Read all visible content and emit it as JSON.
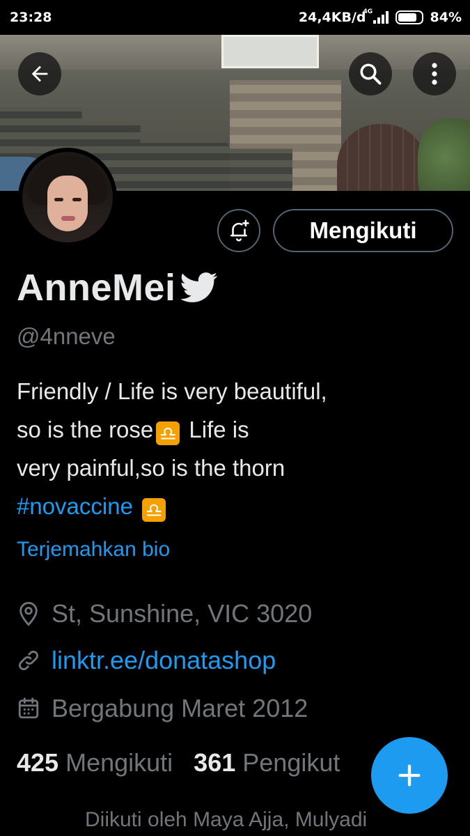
{
  "status_bar": {
    "time": "23:28",
    "network_speed": "24,4KB/d",
    "network_type": "4G",
    "battery_percent": "84%",
    "battery_level": 0.84
  },
  "header": {
    "back_icon": "arrow-left-icon",
    "search_icon": "search-icon",
    "more_icon": "more-vertical-icon"
  },
  "profile": {
    "name": "AnneMei",
    "handle": "@4nneve",
    "bio": {
      "line1": "Friendly / Life is very beautiful,",
      "line2_a": "so is the rose",
      "line2_b": " Life is",
      "line3": "very painful,so is the thorn",
      "hashtag": "#novaccine",
      "emoji": "♎"
    },
    "translate_label": "Terjemahkan bio",
    "location": "St, Sunshine, VIC 3020",
    "website": "linktr.ee/donatashop",
    "joined": "Bergabung Maret 2012"
  },
  "actions": {
    "follow_label": "Mengikuti",
    "notify_icon": "bell-plus-icon"
  },
  "stats": {
    "following_count": "425",
    "following_label": "Mengikuti",
    "followers_count": "361",
    "followers_label": "Pengikut"
  },
  "followed_by": "Diikuti oleh Maya Ajja, Mulyadi",
  "colors": {
    "background": "#000000",
    "accent": "#1d9bf0",
    "secondary_text": "#71767b",
    "border": "#536471",
    "libra_emoji": "#f4a100"
  }
}
